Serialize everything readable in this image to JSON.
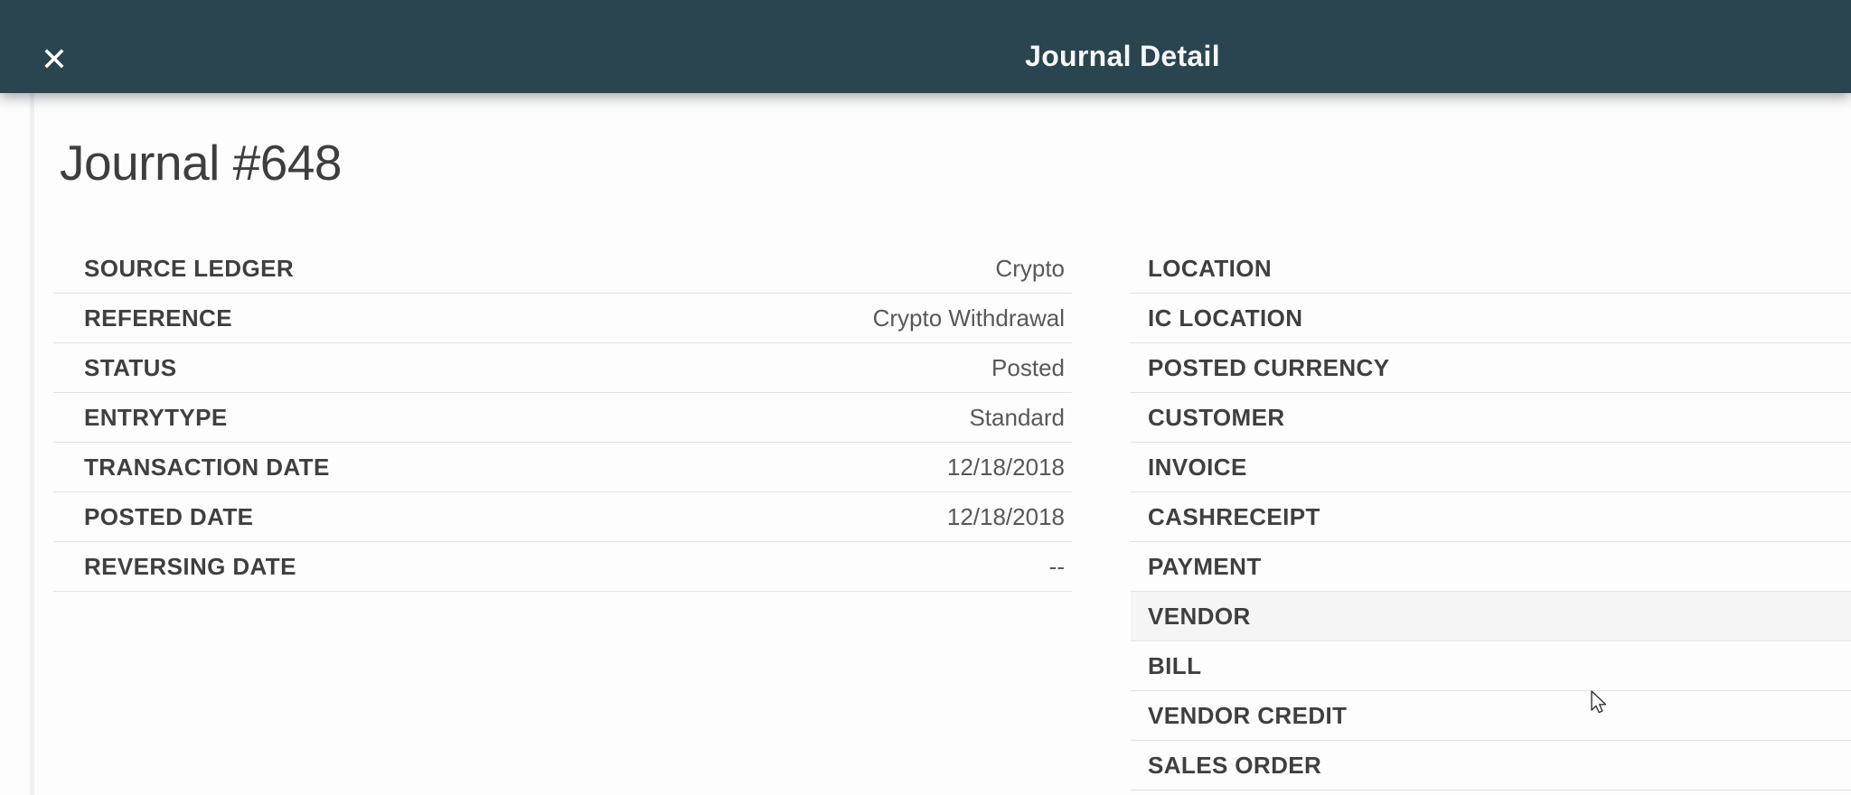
{
  "header": {
    "title": "Journal Detail",
    "close_icon": "✕"
  },
  "journal": {
    "heading": "Journal #648"
  },
  "details_left": [
    {
      "label": "SOURCE LEDGER",
      "value": "Crypto"
    },
    {
      "label": "REFERENCE",
      "value": "Crypto Withdrawal"
    },
    {
      "label": "STATUS",
      "value": "Posted"
    },
    {
      "label": "ENTRYTYPE",
      "value": "Standard"
    },
    {
      "label": "TRANSACTION DATE",
      "value": "12/18/2018"
    },
    {
      "label": "POSTED DATE",
      "value": "12/18/2018"
    },
    {
      "label": "REVERSING DATE",
      "value": "--"
    }
  ],
  "details_right": [
    {
      "label": "LOCATION",
      "value": ""
    },
    {
      "label": "IC LOCATION",
      "value": ""
    },
    {
      "label": "POSTED CURRENCY",
      "value": ""
    },
    {
      "label": "CUSTOMER",
      "value": ""
    },
    {
      "label": "INVOICE",
      "value": ""
    },
    {
      "label": "CASHRECEIPT",
      "value": ""
    },
    {
      "label": "PAYMENT",
      "value": ""
    },
    {
      "label": "VENDOR",
      "value": "",
      "highlighted": true
    },
    {
      "label": "BILL",
      "value": ""
    },
    {
      "label": "VENDOR CREDIT",
      "value": ""
    },
    {
      "label": "SALES ORDER",
      "value": ""
    }
  ],
  "colors": {
    "header_bg": "#2a4450",
    "divider": "#e4e4e4",
    "label": "#3f3f3f",
    "value": "#585858",
    "highlight_row": "#f5f5f5"
  }
}
